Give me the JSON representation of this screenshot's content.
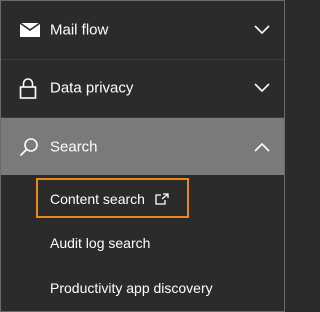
{
  "nav": {
    "items": [
      {
        "label": "Mail flow",
        "icon": "mail-icon",
        "expanded": false
      },
      {
        "label": "Data privacy",
        "icon": "lock-icon",
        "expanded": false
      },
      {
        "label": "Search",
        "icon": "search-icon",
        "expanded": true
      }
    ],
    "search_subitems": [
      {
        "label": "Content search",
        "external_icon": "external-link-icon",
        "highlighted": true
      },
      {
        "label": "Audit log search"
      },
      {
        "label": "Productivity app discovery"
      }
    ]
  },
  "colors": {
    "background": "#2b2b2b",
    "selected_row": "#7a7a7a",
    "text": "#ffffff",
    "highlight_border": "#e8891e"
  }
}
